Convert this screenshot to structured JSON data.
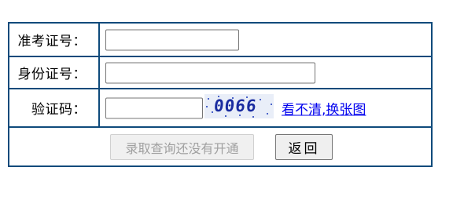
{
  "form": {
    "ticket_label": "准考证号：",
    "ticket_value": "",
    "id_label": "身份证号：",
    "id_value": "",
    "code_label": "验证码：",
    "code_value": "",
    "captcha_text": "0066",
    "refresh_link": "看不清,换张图",
    "submit_label": "录取查询还没有开通",
    "back_label": "返回"
  },
  "colors": {
    "border": "#0e4a7b",
    "link": "#0000ee",
    "captcha_text": "#1a2ca0"
  }
}
